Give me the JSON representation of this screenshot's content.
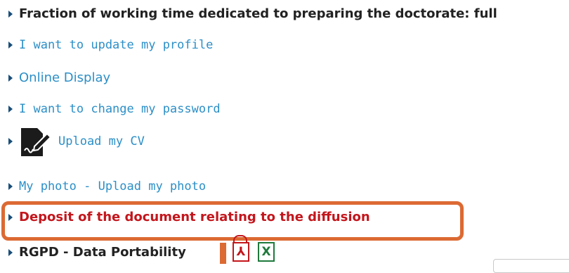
{
  "menu": {
    "fraction_label": "Fraction of working time dedicated to preparing the doctorate: full",
    "update_profile": "I want to update my profile",
    "online_display": "Online Display",
    "change_password": "I want to change my password",
    "upload_cv": "Upload my CV",
    "my_photo": "My photo - Upload my photo",
    "deposit_document": "Deposit of the document relating to the diffusion",
    "rgpd": "RGPD - Data Portability"
  },
  "icons": {
    "bullet": "triangle-right-icon",
    "cv": "document-edit-icon",
    "pdf": "pdf-file-icon",
    "excel": "excel-file-icon"
  },
  "icon_glyphs": {
    "pdf": "⅄",
    "excel": "X"
  },
  "colors": {
    "link": "#2c8fc7",
    "bold_text": "#222222",
    "alert_text": "#c3161c",
    "highlight": "#dc6a33",
    "bullet": "#1a4e78",
    "excel": "#1f7a3c"
  }
}
